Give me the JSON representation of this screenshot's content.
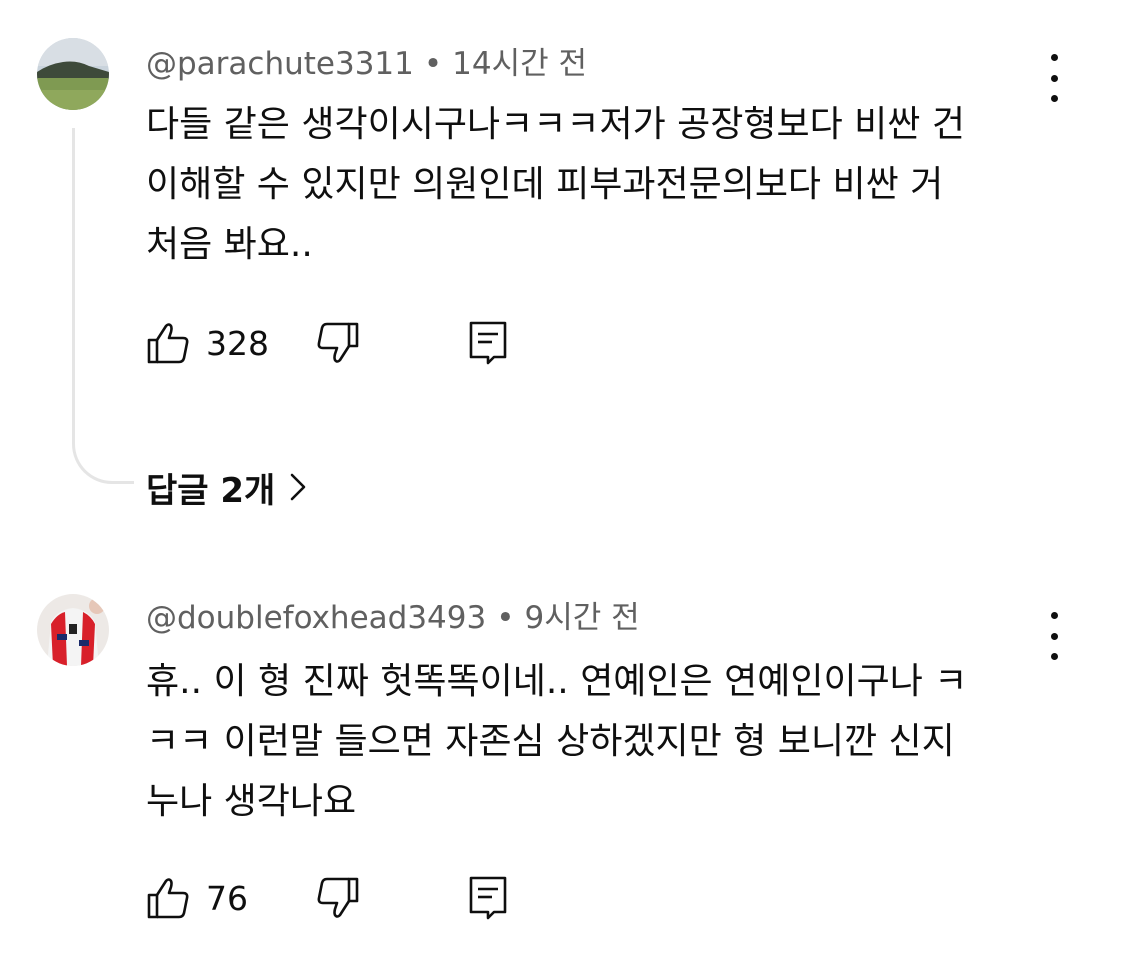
{
  "comments": [
    {
      "author": "@parachute3311",
      "separator": "•",
      "time": "14시간 전",
      "lines": [
        "다들 같은 생각이시구나ㅋㅋㅋ저가 공장형보다 비싼 건",
        "이해할 수 있지만 의원인데 피부과전문의보다 비싼 거",
        "처음 봐요.."
      ],
      "likes": "328",
      "replies_label": "답글 2개",
      "icons": {
        "like": "thumbs-up-icon",
        "dislike": "thumbs-down-icon",
        "reply": "reply-icon",
        "menu": "more-vert-icon"
      }
    },
    {
      "author": "@doublefoxhead3493",
      "separator": "•",
      "time": "9시간 전",
      "lines": [
        "휴.. 이 형 진짜 헛똑똑이네.. 연예인은 연예인이구나 ㅋ",
        "ㅋㅋ 이런말 들으면 자존심 상하겠지만 형 보니깐 신지",
        "누나 생각나요"
      ],
      "likes": "76",
      "icons": {
        "like": "thumbs-up-icon",
        "dislike": "thumbs-down-icon",
        "reply": "reply-icon",
        "menu": "more-vert-icon"
      }
    }
  ],
  "colors": {
    "text": "#0f0f0f",
    "meta": "#606060",
    "thread_line": "#e5e5e5"
  }
}
